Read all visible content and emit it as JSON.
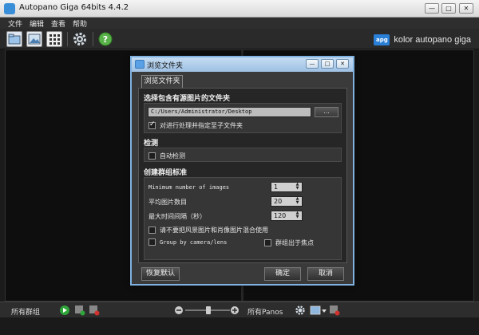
{
  "window": {
    "title": "Autopano Giga 64bits 4.4.2",
    "minimize": "—",
    "maximize": "□",
    "close": "✕"
  },
  "menu": [
    "文件",
    "编辑",
    "查看",
    "帮助"
  ],
  "brand": {
    "logo": "apg",
    "text": "kolor autopano giga"
  },
  "bottombar": {
    "left_label": "所有群组",
    "right_label": "所有Panos"
  },
  "dialog": {
    "title": "浏览文件夹",
    "tab": "浏览文件夹",
    "section_folder": {
      "title": "选择包含有源图片的文件夹",
      "path": "C:/Users/Administrator/Desktop",
      "browse": "...",
      "subfolders_label": "对进行处理并指定至子文件夹",
      "subfolders_checked": true
    },
    "section_detect": {
      "title": "检测",
      "auto_label": "自动检测",
      "auto_checked": false
    },
    "section_group": {
      "title": "创建群组标准",
      "params": [
        {
          "label": "Minimum number of images",
          "value": "1"
        },
        {
          "label": "平均图片数目",
          "value": "20"
        },
        {
          "label": "最大时间间隔（秒）",
          "value": "120"
        }
      ],
      "mix_label": "请不要把风景图片和肖像图片混合使用",
      "mix_checked": false,
      "group_camera_label": "Group by camera/lens",
      "group_camera_checked": false,
      "focus_label": "群组出于焦点",
      "focus_checked": false
    },
    "buttons": {
      "reset": "恢复默认",
      "ok": "确定",
      "cancel": "取消"
    }
  }
}
